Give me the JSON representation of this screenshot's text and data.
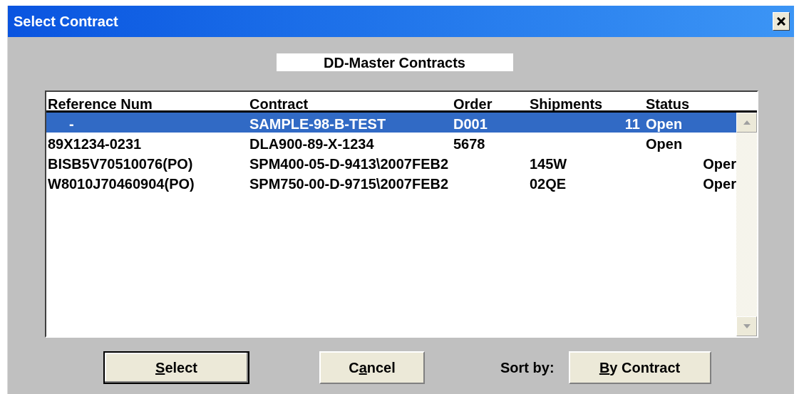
{
  "window": {
    "title": "Select Contract"
  },
  "heading": "DD-Master Contracts",
  "table": {
    "columns": [
      "Reference Num",
      "Contract",
      "Order",
      "Shipments",
      "Status"
    ],
    "rows": [
      {
        "selected": true,
        "reference": "-",
        "contract": "SAMPLE-98-B-TEST",
        "order": "D001",
        "shipments": "11",
        "status": "Open",
        "shipments_right": true
      },
      {
        "selected": false,
        "reference": "89X1234-0231",
        "contract": "DLA900-89-X-1234",
        "order": "5678",
        "status": "Open"
      },
      {
        "selected": false,
        "reference": "BISB5V70510076(PO)",
        "contract": "SPM400-05-D-9413\\2007FEB2",
        "shipments": "145W",
        "status": "Oper",
        "status_right": true
      },
      {
        "selected": false,
        "reference": "W8010J70460904(PO)",
        "contract": "SPM750-00-D-9715\\2007FEB2",
        "shipments": "02QE",
        "status": "Oper",
        "status_right": true
      }
    ]
  },
  "buttons": [
    {
      "kind": "default",
      "mnemonic": "S",
      "after": "elect"
    },
    {
      "kind": "normal",
      "before": "C",
      "mnemonic": "a",
      "after": "ncel"
    }
  ],
  "sort": {
    "label": "Sort by:",
    "button": {
      "kind": "normal",
      "mnemonic": "B",
      "after": "y Contract"
    }
  }
}
